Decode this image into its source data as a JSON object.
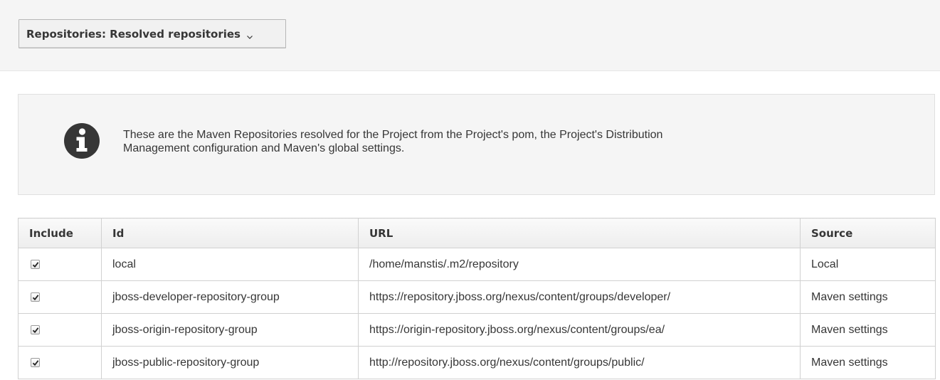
{
  "toolbar": {
    "dropdown_label": "Repositories: Resolved repositories"
  },
  "info": {
    "icon": "info-icon",
    "line1": "These are the Maven Repositories resolved for the Project from the Project's pom, the Project's Distribution",
    "line2": "Management configuration and Maven's global settings."
  },
  "table": {
    "headers": {
      "include": "Include",
      "id": "Id",
      "url": "URL",
      "source": "Source"
    },
    "rows": [
      {
        "include": true,
        "id": "local",
        "url": "/home/manstis/.m2/repository",
        "source": "Local"
      },
      {
        "include": true,
        "id": "jboss-developer-repository-group",
        "url": "https://repository.jboss.org/nexus/content/groups/developer/",
        "source": "Maven settings"
      },
      {
        "include": true,
        "id": "jboss-origin-repository-group",
        "url": "https://origin-repository.jboss.org/nexus/content/groups/ea/",
        "source": "Maven settings"
      },
      {
        "include": true,
        "id": "jboss-public-repository-group",
        "url": "http://repository.jboss.org/nexus/content/groups/public/",
        "source": "Maven settings"
      }
    ]
  }
}
